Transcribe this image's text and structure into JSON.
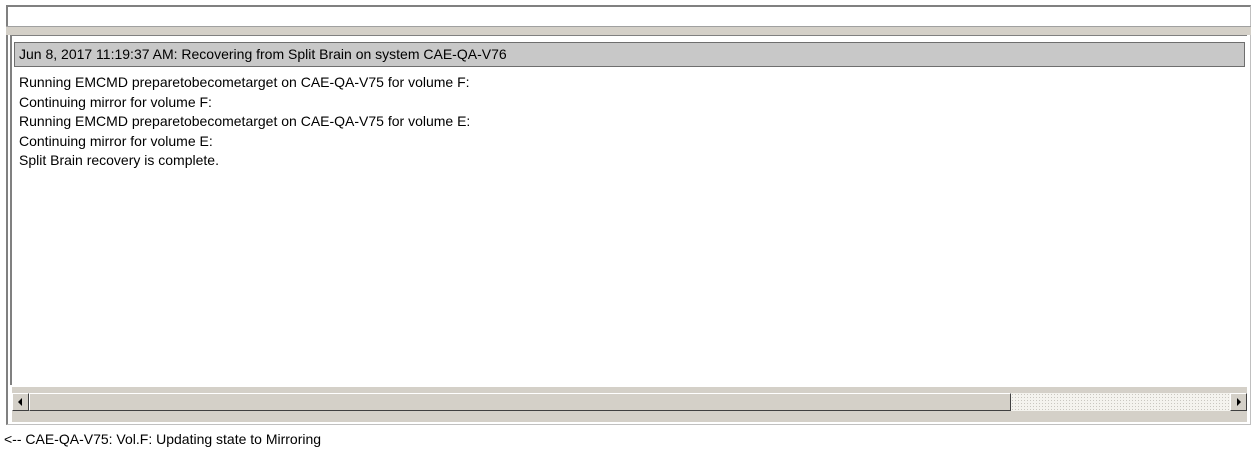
{
  "log": {
    "header": "Jun 8, 2017 11:19:37 AM: Recovering from Split Brain on system CAE-QA-V76",
    "lines": [
      "Running EMCMD preparetobecometarget on CAE-QA-V75 for volume F:",
      "Continuing mirror for volume F:",
      "Running EMCMD preparetobecometarget on CAE-QA-V75 for volume E:",
      "Continuing mirror for volume E:",
      "Split Brain recovery is complete."
    ]
  },
  "scrollbar": {
    "left_icon": "arrow-left-icon",
    "right_icon": "arrow-right-icon"
  },
  "status": {
    "text": "<-- CAE-QA-V75: Vol.F: Updating state to Mirroring"
  }
}
